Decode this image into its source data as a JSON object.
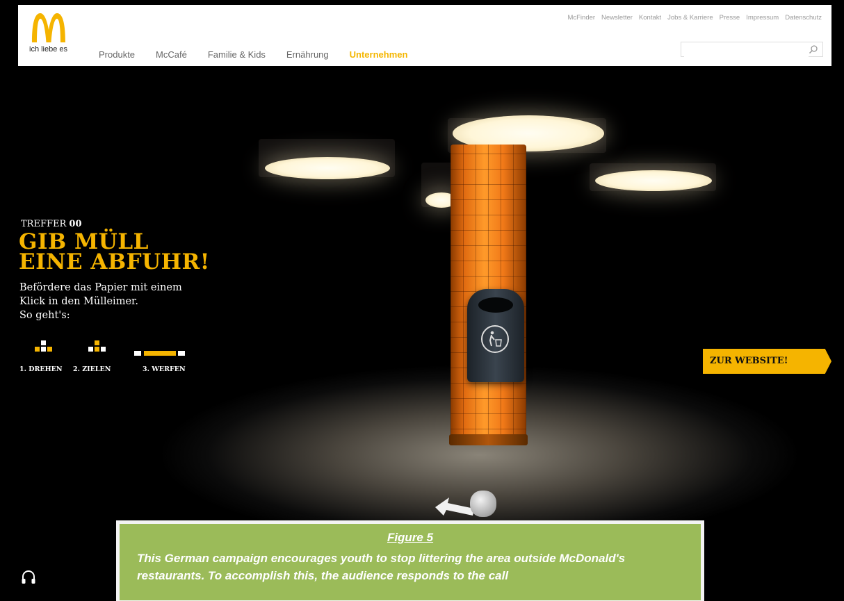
{
  "header": {
    "logo_icon": "mcdonalds-golden-arches-icon",
    "tagline": "ich liebe es",
    "nav": [
      "Produkte",
      "McCafé",
      "Familie & Kids",
      "Ernährung",
      "Unternehmen"
    ],
    "active_nav": "Unternehmen",
    "util_links": [
      "McFinder",
      "Newsletter",
      "Kontakt",
      "Jobs & Karriere",
      "Presse",
      "Impressum",
      "Datenschutz"
    ],
    "search": {
      "value": "",
      "placeholder": "",
      "icon": "search-icon"
    }
  },
  "game": {
    "score_label": "TREFFER",
    "score_value": "00",
    "headline_line1": "GIB MÜLL",
    "headline_line2": "EINE ABFUHR!",
    "instructions": [
      "Befördere das Papier mit einem",
      "Klick in den Mülleimer.",
      "So geht's:"
    ],
    "steps": [
      "1. DREHEN",
      "2. ZIELEN",
      "3. WERFEN"
    ]
  },
  "cta": {
    "label": "ZUR WEBSITE!"
  },
  "audio_icon": "headphones-icon",
  "caption": {
    "title": "Figure 5",
    "text": "This German campaign encourages youth to stop littering the area outside McDonald's restaurants. To accomplish this, the audience responds to the call"
  },
  "colors": {
    "accent": "#f5b400",
    "pillar": "#f07818",
    "caption_bg": "#9bbb59"
  }
}
